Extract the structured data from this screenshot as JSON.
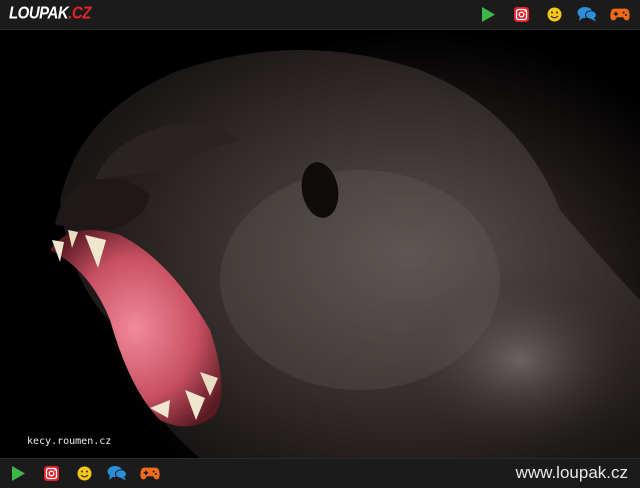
{
  "header": {
    "logo_main": "LOUPAK",
    "logo_sep": ".",
    "logo_tld": "CZ",
    "icons": [
      "play-icon",
      "instagram-icon",
      "smiley-icon",
      "chat-icon",
      "gamepad-icon"
    ]
  },
  "photo": {
    "subject": "gorilla-roaring",
    "watermark": "kecy.roumen.cz"
  },
  "footer": {
    "icons": [
      "play-icon",
      "instagram-icon",
      "smiley-icon",
      "chat-icon",
      "gamepad-icon"
    ],
    "site_url": "www.loupak.cz"
  },
  "colors": {
    "bar_bg": "#1b1b1b",
    "play": "#3db64a",
    "instagram": "#e2232b",
    "smiley": "#f5c518",
    "chat": "#2a8fd8",
    "gamepad": "#f26b1d"
  }
}
